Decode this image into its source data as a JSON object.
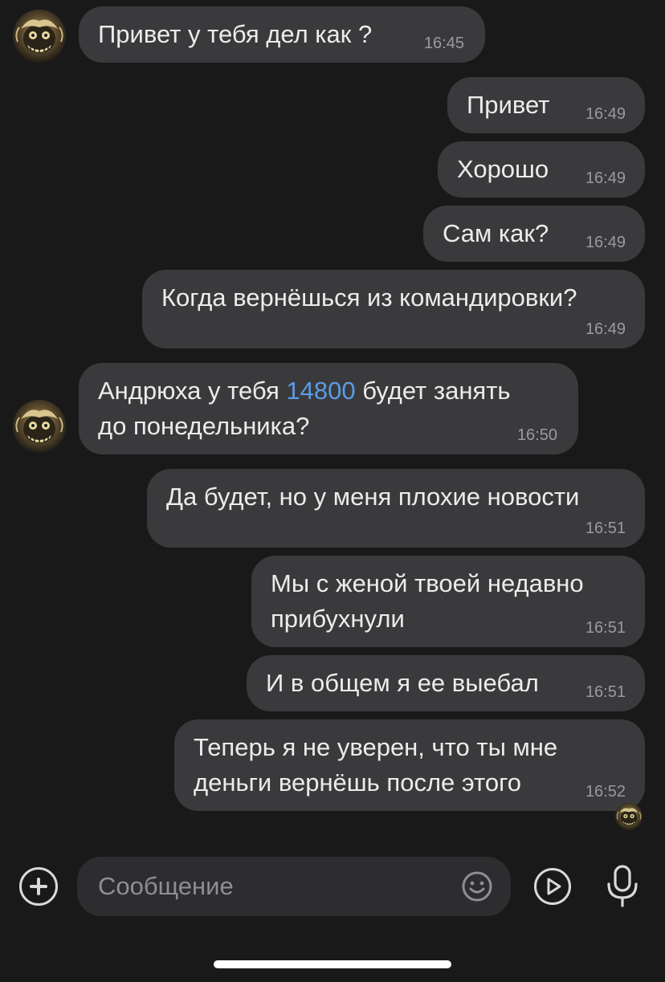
{
  "messages": [
    {
      "text": "Привет у тебя дел как ?",
      "time": "16:45"
    },
    {
      "text": "Привет",
      "time": "16:49"
    },
    {
      "text": "Хорошо",
      "time": "16:49"
    },
    {
      "text": "Сам как?",
      "time": "16:49"
    },
    {
      "text": "Когда вернёшься из командировки?",
      "time": "16:49"
    },
    {
      "text_before": "Андрюха у тебя ",
      "amount": "14800",
      "text_after": " будет занять\nдо понедельника?",
      "time": "16:50"
    },
    {
      "text": "Да будет, но у меня плохие новости",
      "time": "16:51"
    },
    {
      "text": "Мы с женой твоей недавно\nприбухнули",
      "time": "16:51"
    },
    {
      "text": "И в общем я ее выебал",
      "time": "16:51"
    },
    {
      "text": "Теперь я не уверен, что ты мне\nденьги вернёшь после этого",
      "time": "16:52"
    }
  ],
  "composer": {
    "placeholder": "Сообщение",
    "icons": [
      "plus-icon",
      "emoji-icon",
      "video-message-icon",
      "microphone-icon"
    ]
  },
  "colors": {
    "background": "#19191a",
    "bubble": "#3a3a3c",
    "link": "#5b9be6",
    "time": "#9a9a9f"
  }
}
